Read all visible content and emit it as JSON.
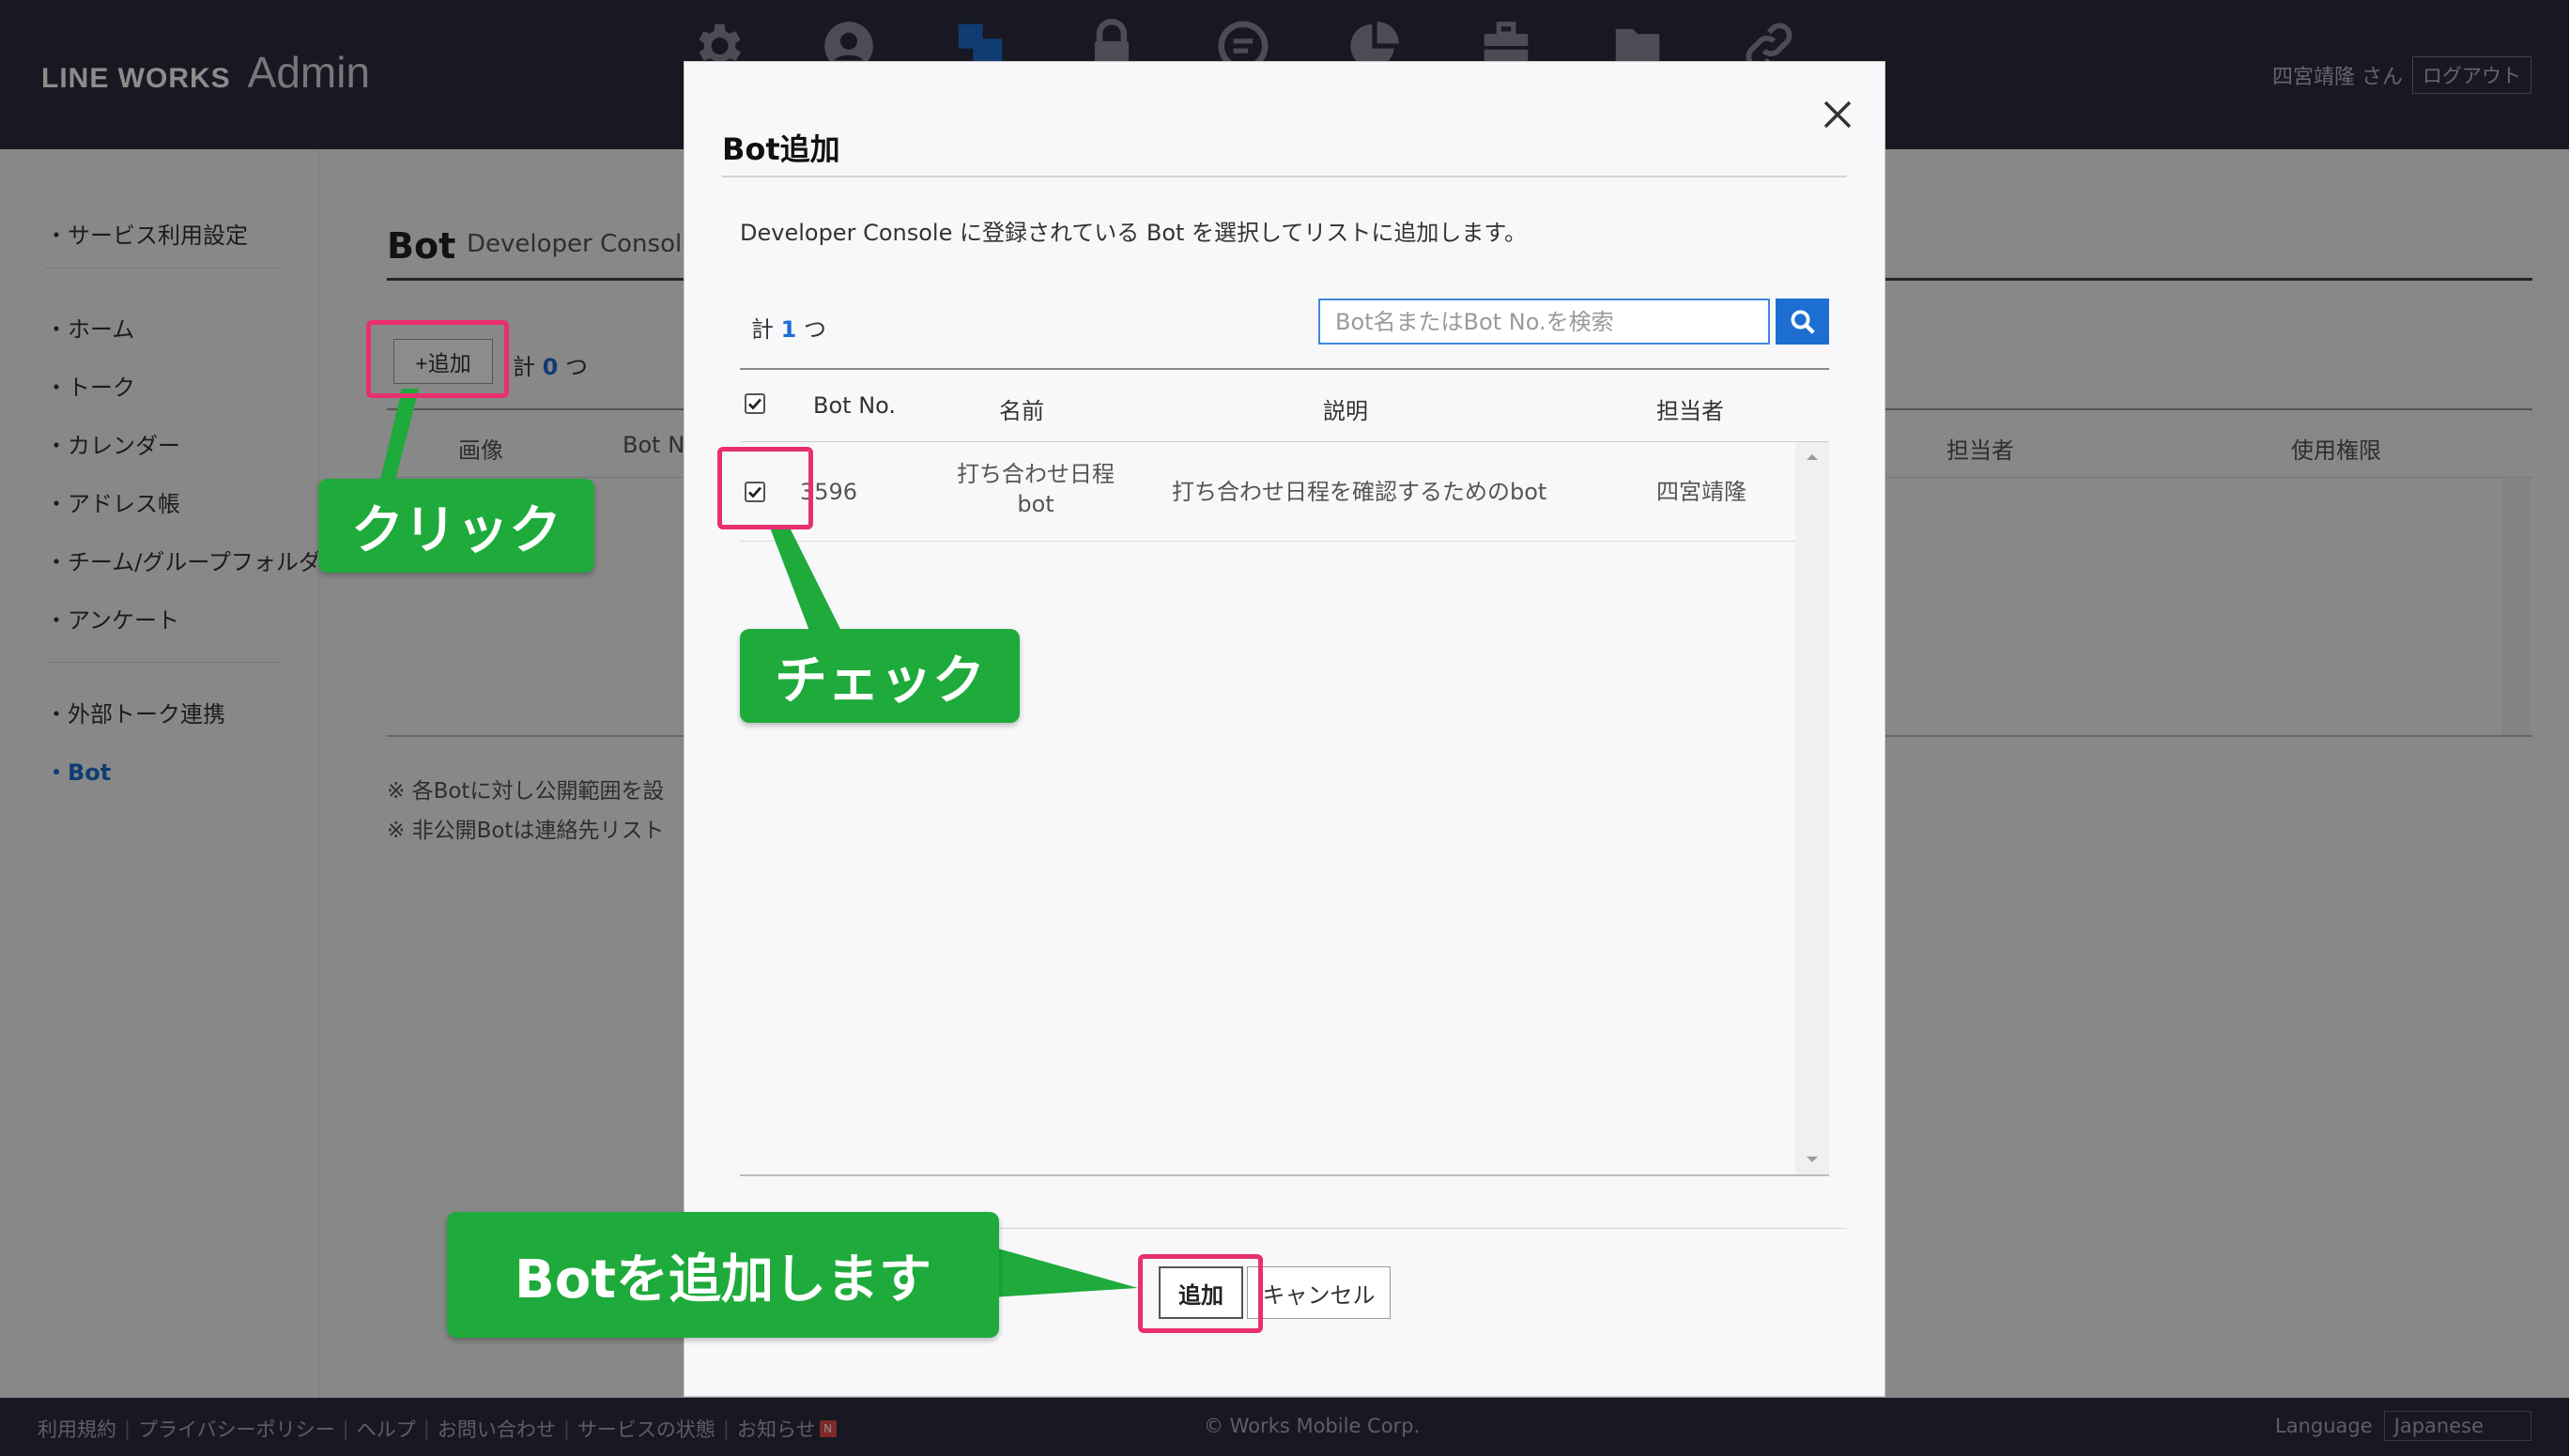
{
  "header": {
    "logo_line": "LINE WORKS",
    "logo_admin": "Admin",
    "user_name": "四宮靖隆 さん",
    "logout_label": "ログアウト",
    "nav_icons": [
      "gear-icon",
      "user-icon",
      "service-icon",
      "lock-icon",
      "message-icon",
      "pie-chart-icon",
      "briefcase-icon",
      "folder-icon",
      "link-icon"
    ]
  },
  "sidebar": {
    "items": [
      {
        "label": "・サービス利用設定"
      },
      {
        "label": "・ホーム"
      },
      {
        "label": "・トーク"
      },
      {
        "label": "・カレンダー"
      },
      {
        "label": "・アドレス帳"
      },
      {
        "label": "・チーム/グループフォルダ"
      },
      {
        "label": "・アンケート"
      },
      {
        "label": "・外部トーク連携"
      },
      {
        "label": "・Bot"
      }
    ]
  },
  "page": {
    "title": "Bot",
    "subtitle": "Developer Console",
    "add_label": "+追加",
    "count_prefix": "計",
    "count_value": "0",
    "count_suffix": "つ",
    "columns": [
      "画像",
      "Bot N",
      "担当者",
      "使用権限"
    ],
    "notes": [
      "※ 各Botに対し公開範囲を設",
      "※ 非公開Botは連絡先リスト"
    ]
  },
  "modal": {
    "title": "Bot追加",
    "description": "Developer Console に登録されている Bot を選択してリストに追加します。",
    "count_prefix": "計",
    "count_value": "1",
    "count_suffix": "つ",
    "search_placeholder": "Bot名またはBot No.を検索",
    "columns": [
      "Bot No.",
      "名前",
      "説明",
      "担当者"
    ],
    "rows": [
      {
        "checked": true,
        "bot_no": "3596",
        "name_line1": "打ち合わせ日程",
        "name_line2": "bot",
        "description": "打ち合わせ日程を確認するためのbot",
        "owner": "四宮靖隆"
      }
    ],
    "add_button": "追加",
    "cancel_button": "キャンセル"
  },
  "annotations": {
    "click": "クリック",
    "check": "チェック",
    "add_bot": "Botを追加します",
    "highlight_color": "#e8306e",
    "callout_color": "#1faa3c"
  },
  "footer": {
    "links": [
      "利用規約",
      "プライバシーポリシー",
      "ヘルプ",
      "お問い合わせ",
      "サービスの状態",
      "お知らせ"
    ],
    "new_badge": "N",
    "copyright": "© Works Mobile Corp.",
    "language_label": "Language",
    "language_value": "Japanese"
  }
}
